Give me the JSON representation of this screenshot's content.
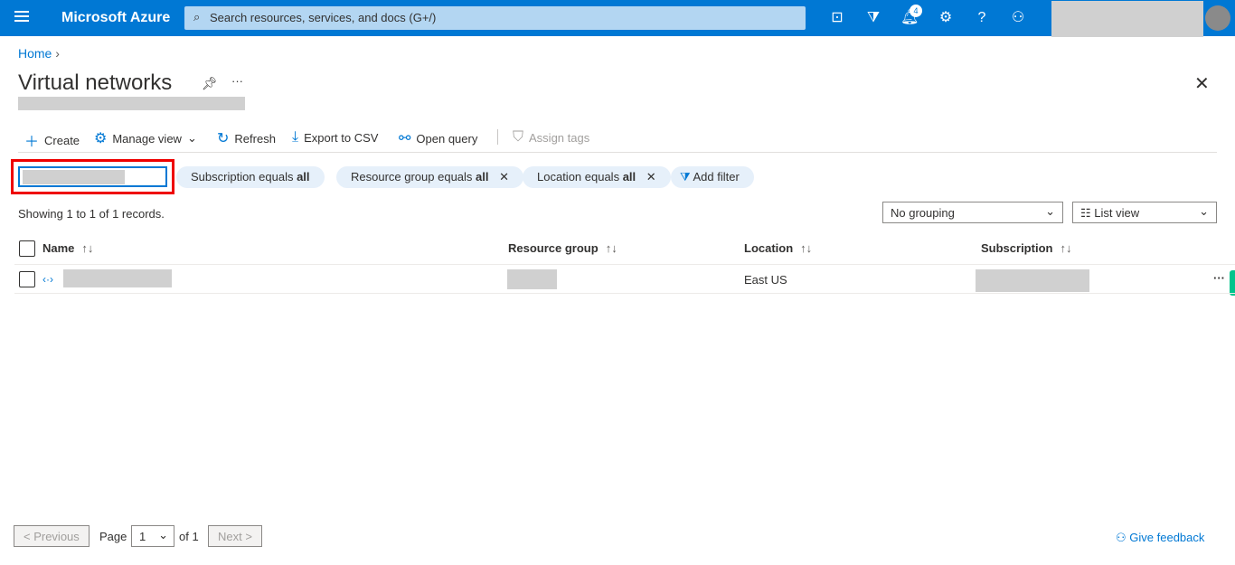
{
  "header": {
    "brand": "Microsoft Azure",
    "search_placeholder": "Search resources, services, and docs (G+/)",
    "notifications_count": "4",
    "icons": [
      "menu-icon",
      "cloud-shell-icon",
      "directory-filter-icon",
      "bell-icon",
      "gear-icon",
      "help-icon",
      "feedback-icon"
    ]
  },
  "breadcrumb": {
    "home": "Home"
  },
  "page": {
    "title": "Virtual networks"
  },
  "toolbar": {
    "create": "Create",
    "manage_view": "Manage view",
    "refresh": "Refresh",
    "export": "Export to CSV",
    "open_query": "Open query",
    "assign_tags": "Assign tags"
  },
  "filters": {
    "subscription": "Subscription equals ",
    "resource_group": "Resource group equals ",
    "location": "Location equals ",
    "all": "all",
    "add_filter": "Add filter"
  },
  "records": "Showing 1 to 1 of 1 records.",
  "grouping": "No grouping",
  "view": "List view",
  "table": {
    "columns": [
      "Name",
      "Resource group",
      "Location",
      "Subscription"
    ],
    "rows": [
      {
        "location": "East US"
      }
    ]
  },
  "pagination": {
    "previous": "< Previous",
    "page": "Page",
    "current": "1",
    "of": "of 1",
    "next": "Next >"
  },
  "feedback": "Give feedback"
}
